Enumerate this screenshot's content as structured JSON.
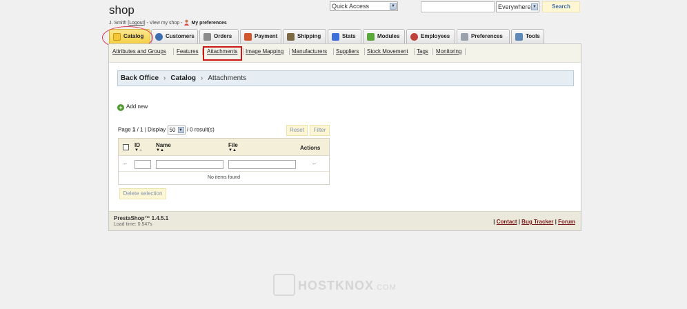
{
  "header": {
    "shop_name": "shop",
    "user": "J. Smith",
    "logout": "Logout",
    "view_shop": "View my shop",
    "preferences": "My preferences",
    "quick_access": "Quick Access",
    "search_scope": "Everywhere",
    "search_button": "Search"
  },
  "tabs": [
    {
      "label": "Catalog",
      "color": "#e7b41c"
    },
    {
      "label": "Customers",
      "color": "#3c6fb0"
    },
    {
      "label": "Orders",
      "color": "#8a8a8a"
    },
    {
      "label": "Payment",
      "color": "#d2562d"
    },
    {
      "label": "Shipping",
      "color": "#7a6a44"
    },
    {
      "label": "Stats",
      "color": "#3d6fd8"
    },
    {
      "label": "Modules",
      "color": "#5aa83a"
    },
    {
      "label": "Employees",
      "color": "#c0413a"
    },
    {
      "label": "Preferences",
      "color": "#9aa2ad"
    },
    {
      "label": "Tools",
      "color": "#5f8ab8"
    }
  ],
  "subnav": [
    "Attributes and Groups",
    "Features",
    "Attachments",
    "Image Mapping",
    "Manufacturers",
    "Suppliers",
    "Stock Movement",
    "Tags",
    "Monitoring"
  ],
  "breadcrumb": {
    "root": "Back Office",
    "section": "Catalog",
    "current": "Attachments"
  },
  "add_new": "Add new",
  "pager": {
    "page_label": "Page",
    "page": "1",
    "total": "1",
    "display_label": "Display",
    "per_page": "50",
    "results": "/ 0 result(s)"
  },
  "buttons": {
    "reset": "Reset",
    "filter": "Filter",
    "delete": "Delete selection"
  },
  "grid": {
    "headers": [
      "ID",
      "Name",
      "File",
      "Actions"
    ],
    "filter_placeholder_dash": "--",
    "empty": "No items found"
  },
  "footer": {
    "version": "PrestaShop™ 1.4.5.1",
    "load_time": "Load time: 0.547s",
    "links": [
      "Contact",
      "Bug Tracker",
      "Forum"
    ]
  },
  "watermark": {
    "brand": "HOSTKNOX",
    "suffix": ".COM"
  }
}
